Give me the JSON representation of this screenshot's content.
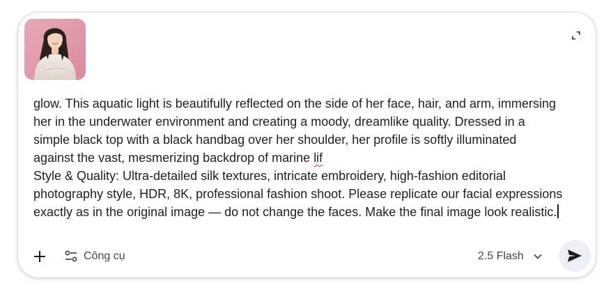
{
  "composer": {
    "attachment": {
      "icon": "image-thumbnail"
    },
    "expand_icon": "expand-icon",
    "prompt_lines": [
      "glow. This aquatic light is beautifully reflected on the side of her face, hair, and arm, immersing",
      "her in the underwater environment and creating a moody, dreamlike quality. Dressed in a",
      "simple black top with a black handbag over her shoulder, her profile is softly illuminated",
      "against the vast, mesmerizing backdrop of marine ",
      "lif",
      "Style & Quality: Ultra-detailed silk textures, intricate embroidery, high-fashion editorial",
      "photography style, HDR, 8K, professional fashion shoot. Please replicate our facial expressions",
      "exactly as in the original image — do not change the faces. Make the final image look realistic."
    ],
    "toolbar": {
      "add_icon": "plus-icon",
      "tools_icon": "tune-icon",
      "tools_label": "Công cụ",
      "model_label": "2.5 Flash",
      "model_dropdown_icon": "chevron-down-icon",
      "send_icon": "send-icon"
    }
  }
}
